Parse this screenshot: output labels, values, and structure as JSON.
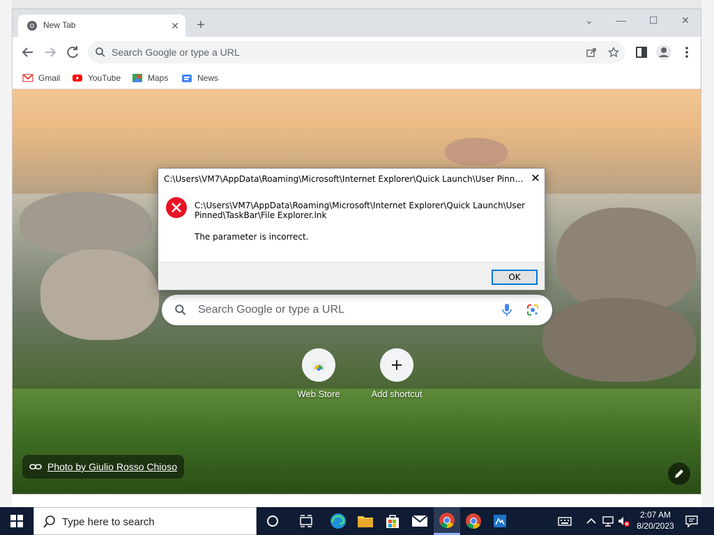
{
  "browser": {
    "tab": {
      "title": "New Tab"
    },
    "omnibox": {
      "placeholder": "Search Google or type a URL"
    },
    "bookmarks": [
      {
        "label": "Gmail",
        "icon": "gmail-icon"
      },
      {
        "label": "YouTube",
        "icon": "youtube-icon"
      },
      {
        "label": "Maps",
        "icon": "maps-icon"
      },
      {
        "label": "News",
        "icon": "news-icon"
      }
    ]
  },
  "ntp": {
    "search_placeholder": "Search Google or type a URL",
    "shortcuts": [
      {
        "label": "Web Store",
        "icon": "web-store-icon"
      },
      {
        "label": "Add shortcut",
        "icon": "plus-icon"
      }
    ],
    "photo_credit": "Photo by Giulio Rosso Chioso"
  },
  "dialog": {
    "title": "C:\\Users\\VM7\\AppData\\Roaming\\Microsoft\\Internet Explorer\\Quick Launch\\User Pinned\\TaskB...",
    "message_path": "C:\\Users\\VM7\\AppData\\Roaming\\Microsoft\\Internet Explorer\\Quick Launch\\User Pinned\\TaskBar\\File Explorer.lnk",
    "message": "The parameter is incorrect.",
    "ok_label": "OK"
  },
  "taskbar": {
    "search_placeholder": "Type here to search",
    "time": "2:07 AM",
    "date": "8/20/2023"
  },
  "colors": {
    "accent": "#0078d7",
    "error_red": "#e81123",
    "taskbar_bg": "#0f1c33"
  }
}
